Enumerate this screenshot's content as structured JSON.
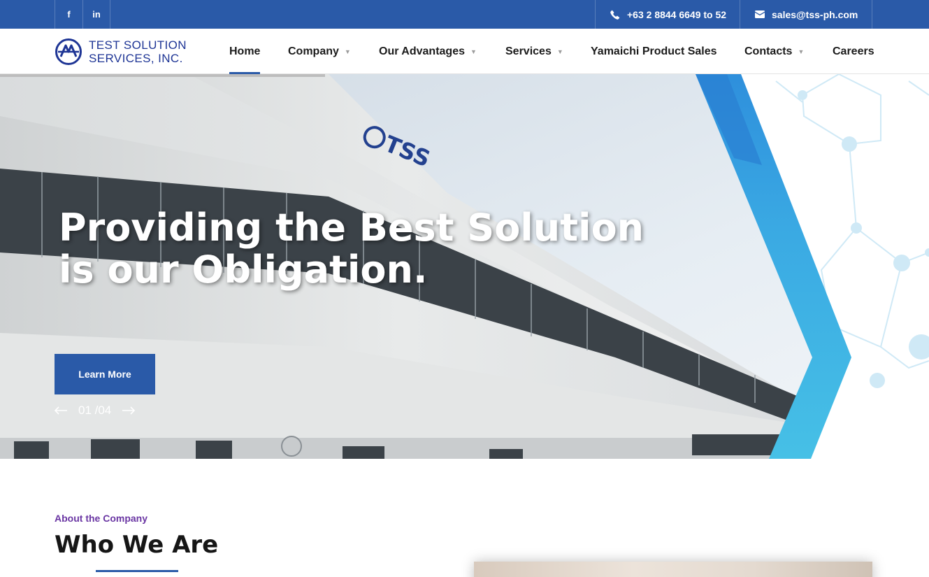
{
  "topbar": {
    "social": [
      {
        "name": "facebook",
        "glyph": "f"
      },
      {
        "name": "linkedin",
        "glyph": "in"
      }
    ],
    "phone": "+63 2 8844 6649 to 52",
    "email": "sales@tss-ph.com"
  },
  "header": {
    "logo_line1": "TEST SOLUTION",
    "logo_line2": "SERVICES, INC.",
    "nav": [
      {
        "label": "Home",
        "active": true,
        "dropdown": false
      },
      {
        "label": "Company",
        "active": false,
        "dropdown": true
      },
      {
        "label": "Our Advantages",
        "active": false,
        "dropdown": true
      },
      {
        "label": "Services",
        "active": false,
        "dropdown": true
      },
      {
        "label": "Yamaichi Product Sales",
        "active": false,
        "dropdown": false
      },
      {
        "label": "Contacts",
        "active": false,
        "dropdown": true
      },
      {
        "label": "Careers",
        "active": false,
        "dropdown": false
      }
    ]
  },
  "hero": {
    "title_line1": "Providing the Best Solution",
    "title_line2": "is our Obligation.",
    "button_label": "Learn More",
    "counter": "01 /04",
    "building_sign": "TSS"
  },
  "about": {
    "label": "About the Company",
    "title": "Who We Are"
  },
  "colors": {
    "brand_blue": "#2a5aa8",
    "accent_cyan": "#3db8e3",
    "label_purple": "#6a36a3"
  }
}
